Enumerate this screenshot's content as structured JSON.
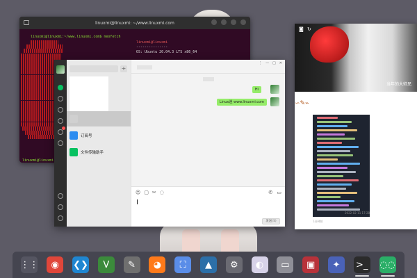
{
  "terminal": {
    "title": "linuxmi@linuxmi: ~/www.linuxmi.com",
    "command_line": "linuxmi@linuxmi:~/www.linuxmi.com$ neofetch",
    "info_user": "linuxmi@linuxmi",
    "info_sep": "---------------",
    "info_os": "OS: Ubuntu 20.04.3 LTS x86_64",
    "prompt": "linuxmi@linuxmi:~/www.linuxmi.com$"
  },
  "wechat": {
    "search_placeholder": "",
    "add_label": "+",
    "chats": [
      {
        "name": "订阅号",
        "time": "",
        "preview": ""
      },
      {
        "name": "文件传输助手",
        "time": "",
        "preview": ""
      }
    ],
    "window_controls": [
      "⋮",
      "—",
      "□",
      "✕"
    ],
    "messages": [
      {
        "text": "Hi"
      },
      {
        "text": "Linux迷 www.linuxmi.com"
      }
    ],
    "send_label": "发送(S)"
  },
  "viewer": {
    "hero_caption": "当年的大帅兄",
    "footer_text": "1分钟前",
    "photo_date": "2022-02-11 17:28"
  },
  "dock": {
    "apps": [
      {
        "name": "app-launcher",
        "glyph": "⋮⋮",
        "color": "#555561"
      },
      {
        "name": "chrome",
        "glyph": "◉",
        "color": "#e0463a"
      },
      {
        "name": "vscode",
        "glyph": "❮❯",
        "color": "#1f86d1"
      },
      {
        "name": "vim",
        "glyph": "V",
        "color": "#3b8a3b"
      },
      {
        "name": "tools",
        "glyph": "✎",
        "color": "#6f6f6f"
      },
      {
        "name": "firefox",
        "glyph": "◕",
        "color": "#ff7a1a"
      },
      {
        "name": "screenshot",
        "glyph": "⛶",
        "color": "#5a8de8"
      },
      {
        "name": "image-viewer",
        "glyph": "▲",
        "color": "#2c6fa8"
      },
      {
        "name": "settings",
        "glyph": "⚙",
        "color": "#6a6a72"
      },
      {
        "name": "toggle-app",
        "glyph": "◐",
        "color": "#d7d2e8"
      },
      {
        "name": "files",
        "glyph": "▭",
        "color": "#8f8f97"
      },
      {
        "name": "media-player",
        "glyph": "▣",
        "color": "#b8323a"
      },
      {
        "name": "game",
        "glyph": "✦",
        "color": "#4a62b8"
      },
      {
        "name": "terminal",
        "glyph": ">_",
        "color": "#2b2b2b"
      },
      {
        "name": "wechat",
        "glyph": "◌◌",
        "color": "#2aae67"
      }
    ]
  }
}
